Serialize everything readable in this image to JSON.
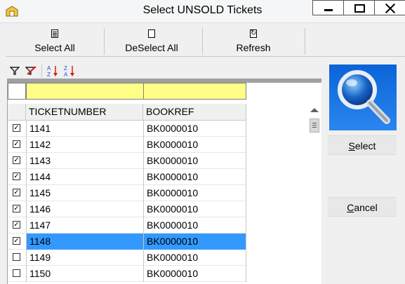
{
  "window": {
    "title": "Select UNSOLD Tickets"
  },
  "toolbar": {
    "select_all": "Select All",
    "deselect_all": "DeSelect All",
    "refresh": "Refresh"
  },
  "grid": {
    "columns": [
      "TICKETNUMBER",
      "BOOKREF"
    ],
    "rows": [
      {
        "checked": true,
        "ticket": "1141",
        "bookref": "BK0000010"
      },
      {
        "checked": true,
        "ticket": "1142",
        "bookref": "BK0000010"
      },
      {
        "checked": true,
        "ticket": "1143",
        "bookref": "BK0000010"
      },
      {
        "checked": true,
        "ticket": "1144",
        "bookref": "BK0000010"
      },
      {
        "checked": true,
        "ticket": "1145",
        "bookref": "BK0000010"
      },
      {
        "checked": true,
        "ticket": "1146",
        "bookref": "BK0000010"
      },
      {
        "checked": true,
        "ticket": "1147",
        "bookref": "BK0000010"
      },
      {
        "checked": true,
        "ticket": "1148",
        "bookref": "BK0000010",
        "selected": true
      },
      {
        "checked": false,
        "ticket": "1149",
        "bookref": "BK0000010"
      },
      {
        "checked": false,
        "ticket": "1150",
        "bookref": "BK0000010"
      }
    ]
  },
  "actions": {
    "select": "Select",
    "cancel": "Cancel"
  },
  "colors": {
    "filter_row": "#ffff88",
    "selection": "#3399ff",
    "magnifier_bg": "#1a73e8"
  }
}
